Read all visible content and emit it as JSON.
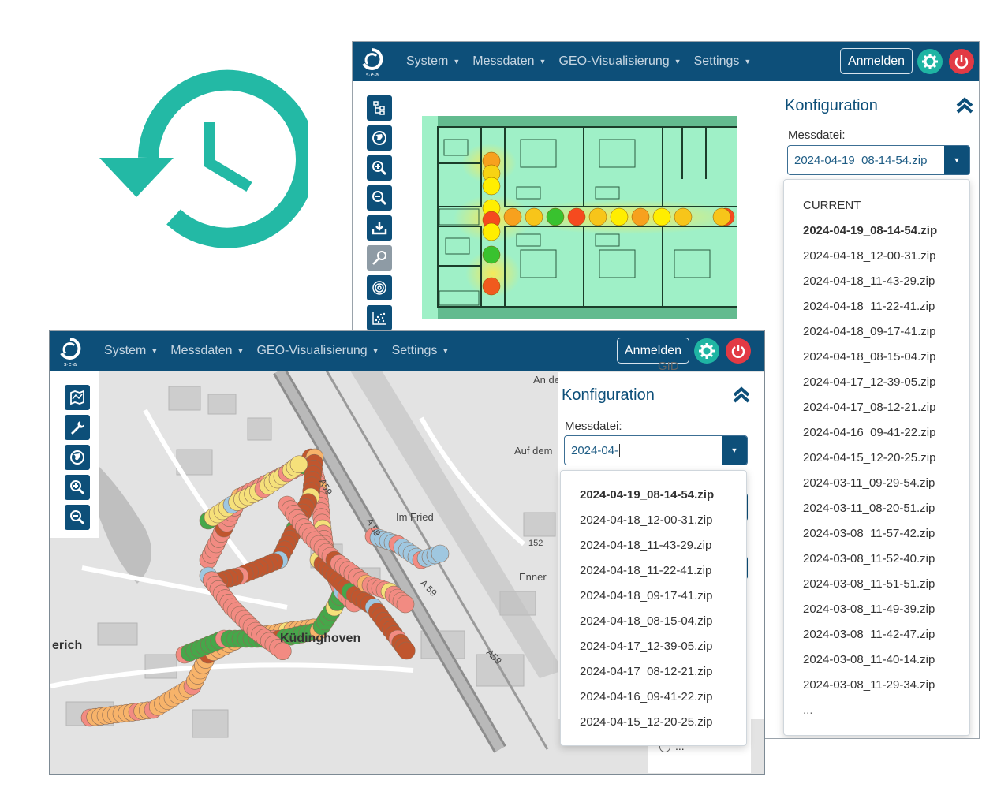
{
  "colors": {
    "navbar": "#0d4f79",
    "accent_teal": "#1fb5a3",
    "power_red": "#e23a44",
    "history_icon": "#23b9a5"
  },
  "decor": {
    "history_icon": "history-icon"
  },
  "back_window": {
    "logo_text": "s·e·a",
    "nav": {
      "menu": [
        "System",
        "Messdaten",
        "GEO-Visualisierung",
        "Settings"
      ],
      "login_label": "Anmelden"
    },
    "toolbar_icons": [
      "tree-icon",
      "globe-icon",
      "zoom-in-icon",
      "zoom-out-icon",
      "download-icon",
      "probe-icon",
      "fingerprint-icon",
      "scatter-icon"
    ],
    "config": {
      "title": "Konfiguration",
      "file_label": "Messdatei:",
      "file_value": "2024-04-19_08-14-54.zip",
      "dropdown_header": "CURRENT",
      "dropdown_items": [
        "2024-04-19_08-14-54.zip",
        "2024-04-18_12-00-31.zip",
        "2024-04-18_11-43-29.zip",
        "2024-04-18_11-22-41.zip",
        "2024-04-18_09-17-41.zip",
        "2024-04-18_08-15-04.zip",
        "2024-04-17_12-39-05.zip",
        "2024-04-17_08-12-21.zip",
        "2024-04-16_09-41-22.zip",
        "2024-04-15_12-20-25.zip",
        "2024-03-11_09-29-54.zip",
        "2024-03-11_08-20-51.zip",
        "2024-03-08_11-57-42.zip",
        "2024-03-08_11-52-40.zip",
        "2024-03-08_11-51-51.zip",
        "2024-03-08_11-49-39.zip",
        "2024-03-08_11-42-47.zip",
        "2024-03-08_11-40-14.zip",
        "2024-03-08_11-29-34.zip"
      ],
      "dropdown_more": "..."
    }
  },
  "front_window": {
    "logo_text": "s·e·a",
    "nav": {
      "menu": [
        "System",
        "Messdaten",
        "GEO-Visualisierung",
        "Settings"
      ],
      "login_label": "Anmelden"
    },
    "toolbar_icons": [
      "map-icon",
      "wrench-icon",
      "globe-icon",
      "zoom-in-icon",
      "zoom-out-icon"
    ],
    "map_labels": {
      "street1": "An der Bahn",
      "street2": "Auf dem",
      "place": "Im Fried",
      "road": "A59",
      "road2": "A 59",
      "road3": "A 59",
      "road4": "A59",
      "number": "152",
      "hill": "Enner",
      "town": "Küdinghoven",
      "town_left": "erich",
      "partial": "GID"
    },
    "config": {
      "title": "Konfiguration",
      "file_label": "Messdatei:",
      "file_value": "2024-04-",
      "dropdown_items": [
        "2024-04-19_08-14-54.zip",
        "2024-04-18_12-00-31.zip",
        "2024-04-18_11-43-29.zip",
        "2024-04-18_11-22-41.zip",
        "2024-04-18_09-17-41.zip",
        "2024-04-18_08-15-04.zip",
        "2024-04-17_12-39-05.zip",
        "2024-04-17_08-12-21.zip",
        "2024-04-16_09-41-22.zip",
        "2024-04-15_12-20-25.zip"
      ],
      "below_more": "..."
    }
  }
}
